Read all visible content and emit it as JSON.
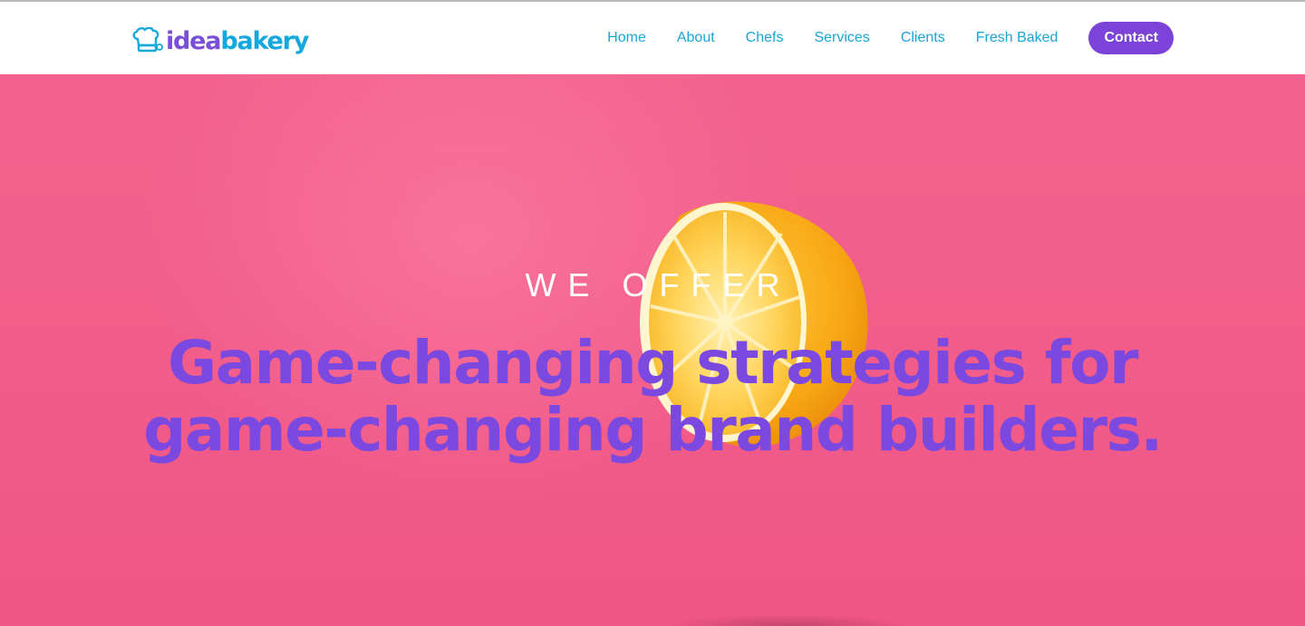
{
  "brand": {
    "logo_part_1": "idea",
    "logo_part_2": "bakery",
    "icon": "chef-hat-icon",
    "colors": {
      "purple": "#7b43d8",
      "blue": "#16a6d8"
    }
  },
  "nav": {
    "items": [
      {
        "label": "Home"
      },
      {
        "label": "About"
      },
      {
        "label": "Chefs"
      },
      {
        "label": "Services"
      },
      {
        "label": "Clients"
      },
      {
        "label": "Fresh Baked"
      }
    ],
    "contact_label": "Contact"
  },
  "hero": {
    "eyebrow": "WE OFFER",
    "headline_line_1": "Game-changing strategies for",
    "headline_line_2": "game-changing brand builders.",
    "background_color": "#f15b89",
    "headline_color": "#7b49e0",
    "image": "lemon-half"
  }
}
